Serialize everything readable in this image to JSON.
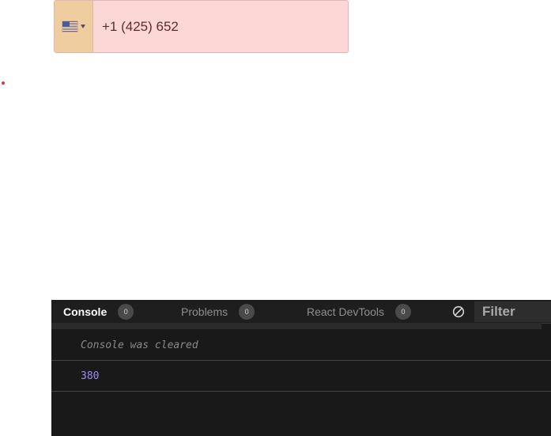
{
  "phone": {
    "value": "+1 (425) 652",
    "country_flag_icon": "us-flag-icon",
    "field_bg_color": "#fdd6d6",
    "country_bg_color": "#efcd9e"
  },
  "console": {
    "tabs": [
      {
        "label": "Console",
        "count": "0",
        "active": true
      },
      {
        "label": "Problems",
        "count": "0",
        "active": false
      },
      {
        "label": "React DevTools",
        "count": "0",
        "active": false
      }
    ],
    "clear_icon": "clear-console-icon",
    "filter_placeholder": "Filter",
    "messages": [
      {
        "text": "Console was cleared",
        "type": "info"
      },
      {
        "text": "380",
        "type": "log"
      }
    ],
    "log_number_color": "#9b8cf2"
  }
}
